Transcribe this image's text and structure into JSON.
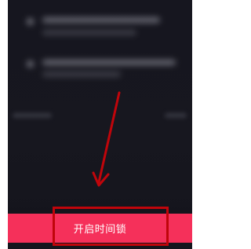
{
  "cta": {
    "label": "开启时间锁",
    "background": "#f5305a",
    "text_color": "#ffffff"
  },
  "annotation": {
    "highlight_color": "#c0050b",
    "arrow_color": "#c0050b"
  },
  "background": {
    "panel_color": "#16161f"
  }
}
